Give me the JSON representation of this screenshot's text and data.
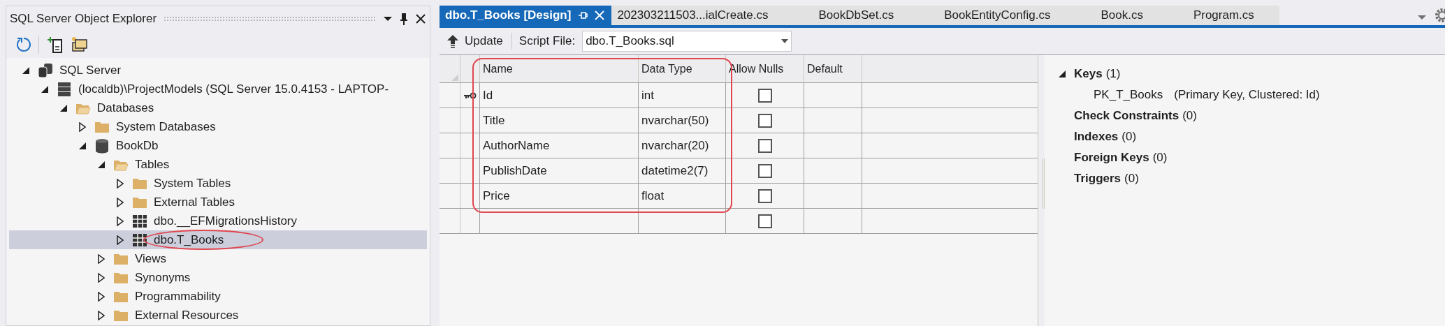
{
  "explorer": {
    "title": "SQL Server Object Explorer",
    "tree": [
      {
        "label": "SQL Server",
        "kind": "servers",
        "expanded": true,
        "selected": false,
        "children": [
          {
            "label": "(localdb)\\ProjectModels (SQL Server 15.0.4153 - LAPTOP-",
            "kind": "server",
            "expanded": true,
            "selected": false,
            "children": [
              {
                "label": "Databases",
                "kind": "folder",
                "expanded": true,
                "selected": false,
                "children": [
                  {
                    "label": "System Databases",
                    "kind": "folder",
                    "expanded": false,
                    "selected": false
                  },
                  {
                    "label": "BookDb",
                    "kind": "database",
                    "expanded": true,
                    "selected": false,
                    "children": [
                      {
                        "label": "Tables",
                        "kind": "folder",
                        "expanded": true,
                        "selected": false,
                        "children": [
                          {
                            "label": "System Tables",
                            "kind": "folder",
                            "expanded": false,
                            "selected": false
                          },
                          {
                            "label": "External Tables",
                            "kind": "folder",
                            "expanded": false,
                            "selected": false
                          },
                          {
                            "label": "dbo.__EFMigrationsHistory",
                            "kind": "table",
                            "expanded": false,
                            "selected": false
                          },
                          {
                            "label": "dbo.T_Books",
                            "kind": "table",
                            "expanded": false,
                            "selected": true
                          }
                        ]
                      },
                      {
                        "label": "Views",
                        "kind": "folder",
                        "expanded": false,
                        "selected": false
                      },
                      {
                        "label": "Synonyms",
                        "kind": "folder",
                        "expanded": false,
                        "selected": false
                      },
                      {
                        "label": "Programmability",
                        "kind": "folder",
                        "expanded": false,
                        "selected": false
                      },
                      {
                        "label": "External Resources",
                        "kind": "folder",
                        "expanded": false,
                        "selected": false
                      }
                    ]
                  }
                ]
              }
            ]
          }
        ]
      }
    ]
  },
  "tabs": [
    {
      "label": "dbo.T_Books [Design]",
      "selected": true
    },
    {
      "label": "202303211503...ialCreate.cs",
      "selected": false
    },
    {
      "label": "BookDbSet.cs",
      "selected": false
    },
    {
      "label": "BookEntityConfig.cs",
      "selected": false
    },
    {
      "label": "Book.cs",
      "selected": false
    },
    {
      "label": "Program.cs",
      "selected": false
    }
  ],
  "toolbar": {
    "update": "Update",
    "script_label": "Script File:",
    "script_file": "dbo.T_Books.sql"
  },
  "grid": {
    "columns": [
      "Name",
      "Data Type",
      "Allow Nulls",
      "Default"
    ],
    "rows": [
      {
        "kind": "column",
        "name": "Id",
        "type": "int",
        "allow_nulls": false,
        "primary_key": true
      },
      {
        "kind": "column",
        "name": "Title",
        "type": "nvarchar(50)",
        "allow_nulls": false,
        "primary_key": false
      },
      {
        "kind": "column",
        "name": "AuthorName",
        "type": "nvarchar(20)",
        "allow_nulls": false,
        "primary_key": false
      },
      {
        "kind": "column",
        "name": "PublishDate",
        "type": "datetime2(7)",
        "allow_nulls": false,
        "primary_key": false
      },
      {
        "kind": "column",
        "name": "Price",
        "type": "float",
        "allow_nulls": false,
        "primary_key": false
      },
      {
        "kind": "new",
        "allow_nulls": false,
        "primary_key": false
      }
    ]
  },
  "properties": [
    {
      "label": "Keys",
      "count": "(1)",
      "expanded": true,
      "children": [
        {
          "name": "PK_T_Books",
          "detail": "(Primary Key, Clustered: Id)"
        }
      ]
    },
    {
      "label": "Check Constraints",
      "count": "(0)"
    },
    {
      "label": "Indexes",
      "count": "(0)"
    },
    {
      "label": "Foreign Keys",
      "count": "(0)"
    },
    {
      "label": "Triggers",
      "count": "(0)"
    }
  ]
}
